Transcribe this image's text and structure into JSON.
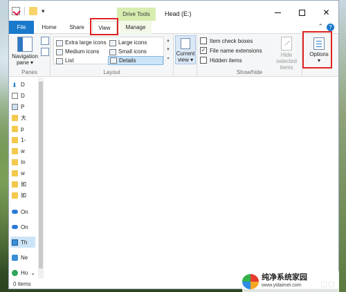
{
  "window": {
    "title": "Head (E:)",
    "contextual_tab": "Drive Tools"
  },
  "quick_access": {
    "icons": [
      "properties-icon",
      "new-folder-icon",
      "customize-caret-icon"
    ]
  },
  "tabs": {
    "file": "File",
    "home": "Home",
    "share": "Share",
    "view": "View",
    "manage": "Manage"
  },
  "ribbon": {
    "panes": {
      "label": "Panes",
      "nav_pane_line1": "Navigation",
      "nav_pane_line2": "pane"
    },
    "layout": {
      "label": "Layout",
      "items": [
        "Extra large icons",
        "Large icons",
        "Medium icons",
        "Small icons",
        "List",
        "Details"
      ],
      "selected": "Details"
    },
    "current_view": {
      "line1": "Current",
      "line2": "view"
    },
    "show_hide": {
      "label": "Show/hide",
      "checkboxes": [
        {
          "label": "Item check boxes",
          "checked": false
        },
        {
          "label": "File name extensions",
          "checked": true
        },
        {
          "label": "Hidden items",
          "checked": false
        }
      ],
      "hide_selected_line1": "Hide selected",
      "hide_selected_line2": "items"
    },
    "options": {
      "label": "Options"
    }
  },
  "nav_pane": {
    "items": [
      {
        "label": "D",
        "icon": "download-icon"
      },
      {
        "label": "D",
        "icon": "document-icon"
      },
      {
        "label": "P",
        "icon": "picture-icon"
      },
      {
        "label": "大",
        "icon": "folder-icon"
      },
      {
        "label": "p",
        "icon": "folder-icon"
      },
      {
        "label": "1-",
        "icon": "folder-icon"
      },
      {
        "label": "w",
        "icon": "folder-icon"
      },
      {
        "label": "In",
        "icon": "folder-icon"
      },
      {
        "label": "w",
        "icon": "folder-icon"
      },
      {
        "label": "如",
        "icon": "folder-icon"
      },
      {
        "label": "如",
        "icon": "folder-icon"
      },
      {
        "label": "On",
        "icon": "onedrive-icon"
      },
      {
        "label": "On",
        "icon": "onedrive-icon"
      },
      {
        "label": "Th",
        "icon": "this-pc-icon"
      },
      {
        "label": "Ne",
        "icon": "network-icon"
      },
      {
        "label": "Ho",
        "icon": "homegroup-icon"
      }
    ]
  },
  "status": {
    "items": "0 items"
  },
  "watermark": {
    "cn": "纯净系统家园",
    "url": "www.yidaimei.com"
  },
  "colors": {
    "accent": "#1979ca",
    "highlight_box": "#e02020",
    "drive_tools": "#d7edb0",
    "selection": "#cce4f7"
  }
}
